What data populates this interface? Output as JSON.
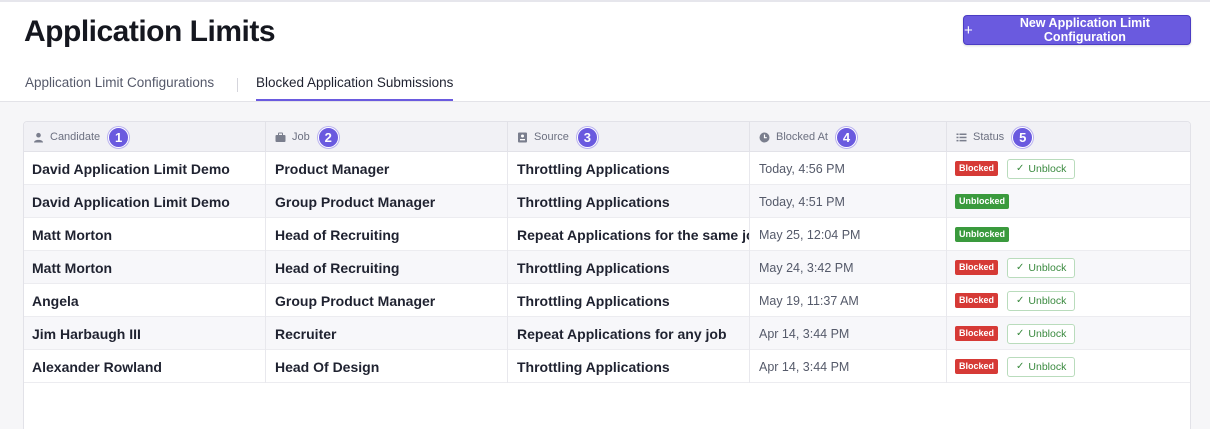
{
  "page": {
    "title": "Application Limits",
    "new_button_label": "New Application Limit Configuration",
    "new_button_icon": "+"
  },
  "tabs": [
    {
      "label": "Application Limit Configurations",
      "active": false
    },
    {
      "label": "Blocked Application Submissions",
      "active": true
    }
  ],
  "table": {
    "columns": [
      {
        "label": "Candidate",
        "icon": "person-icon",
        "badge": "1"
      },
      {
        "label": "Job",
        "icon": "briefcase-icon",
        "badge": "2"
      },
      {
        "label": "Source",
        "icon": "source-icon",
        "badge": "3"
      },
      {
        "label": "Blocked At",
        "icon": "clock-icon",
        "badge": "4"
      },
      {
        "label": "Status",
        "icon": "list-icon",
        "badge": "5"
      }
    ],
    "rows": [
      {
        "candidate": "David Application Limit Demo",
        "job": "Product Manager",
        "source": "Throttling Applications",
        "blocked_at": "Today, 4:56 PM",
        "status": "Blocked",
        "action": "Unblock"
      },
      {
        "candidate": "David Application Limit Demo",
        "job": "Group Product Manager",
        "source": "Throttling Applications",
        "blocked_at": "Today, 4:51 PM",
        "status": "Unblocked",
        "action": ""
      },
      {
        "candidate": "Matt Morton",
        "job": "Head of Recruiting",
        "source": "Repeat Applications for the same job",
        "blocked_at": "May 25, 12:04 PM",
        "status": "Unblocked",
        "action": ""
      },
      {
        "candidate": "Matt Morton",
        "job": "Head of Recruiting",
        "source": "Throttling Applications",
        "blocked_at": "May 24, 3:42 PM",
        "status": "Blocked",
        "action": "Unblock"
      },
      {
        "candidate": "Angela",
        "job": "Group Product Manager",
        "source": "Throttling Applications",
        "blocked_at": "May 19, 11:37 AM",
        "status": "Blocked",
        "action": "Unblock"
      },
      {
        "candidate": "Jim Harbaugh III",
        "job": "Recruiter",
        "source": "Repeat Applications for any job",
        "blocked_at": "Apr 14, 3:44 PM",
        "status": "Blocked",
        "action": "Unblock"
      },
      {
        "candidate": "Alexander Rowland",
        "job": "Head Of Design",
        "source": "Throttling Applications",
        "blocked_at": "Apr 14, 3:44 PM",
        "status": "Blocked",
        "action": "Unblock"
      }
    ]
  },
  "colors": {
    "accent": "#6a5adf",
    "blocked": "#d63a36",
    "unblocked": "#3a9a3d"
  }
}
